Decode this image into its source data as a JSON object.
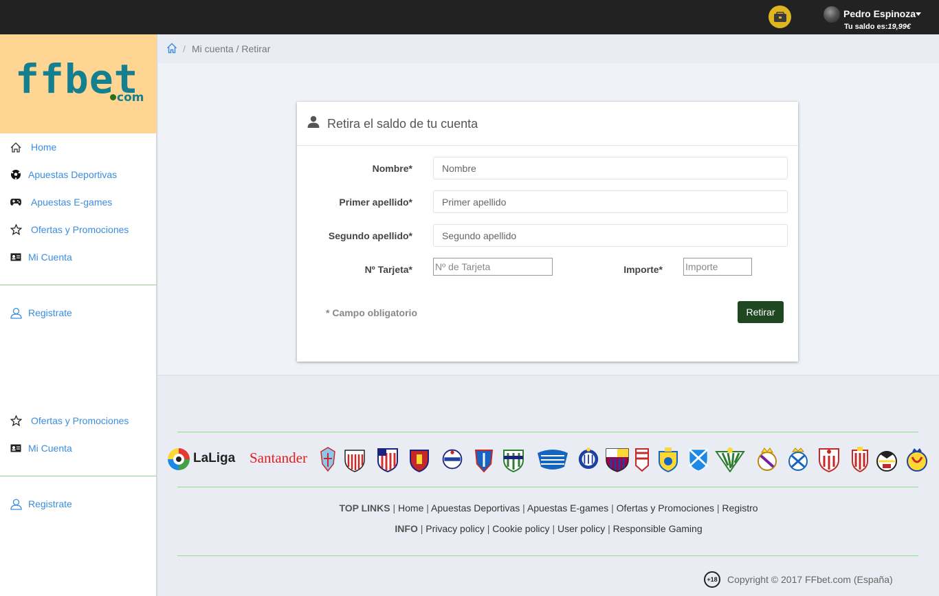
{
  "topbar": {
    "user_name": "Pedro Espinoza",
    "balance_label": "Tu saldo es:",
    "balance_amount": "19,99€",
    "wallet_icon": "wallet-icon"
  },
  "logo": {
    "brand": "ffbet",
    "suffix": "com"
  },
  "sidebar": {
    "items": [
      {
        "label": "Home",
        "icon": "home-icon"
      },
      {
        "label": "Apuestas Deportivas",
        "icon": "soccer-ball-icon"
      },
      {
        "label": "Apuestas E-games",
        "icon": "gamepad-icon"
      },
      {
        "label": "Ofertas y Promociones",
        "icon": "star-icon"
      },
      {
        "label": "Mi Cuenta",
        "icon": "id-card-icon"
      }
    ],
    "register": "Registrate",
    "items2": [
      {
        "label": "Ofertas y Promociones",
        "icon": "star-icon"
      },
      {
        "label": "Mi Cuenta",
        "icon": "id-card-icon"
      }
    ],
    "register2": "Registrate"
  },
  "breadcrumb": {
    "separator": "/",
    "path": "Mi cuenta / Retirar"
  },
  "form": {
    "title": "Retira el saldo de tu cuenta",
    "fields": {
      "nombre": {
        "label": "Nombre*",
        "placeholder": "Nombre"
      },
      "apellido1": {
        "label": "Primer apellido*",
        "placeholder": "Primer apellido"
      },
      "apellido2": {
        "label": "Segundo apellido*",
        "placeholder": "Segundo apellido"
      },
      "tarjeta": {
        "label": "Nº Tarjeta*",
        "placeholder": "Nº de Tarjeta"
      },
      "importe": {
        "label": "Importe*",
        "placeholder": "Importe"
      }
    },
    "required_note": "* Campo obligatorio",
    "submit": "Retirar"
  },
  "footer": {
    "league": {
      "name": "LaLiga",
      "sponsor": "Santander"
    },
    "top_links_heading": "TOP LINKS",
    "top_links": [
      "Home",
      "Apuestas Deportivas",
      "Apuestas E-games",
      "Ofertas y Promociones",
      "Registro"
    ],
    "info_heading": "INFO",
    "info_links": [
      "Privacy policy",
      "Cookie policy",
      "User policy",
      "Responsible Gaming"
    ],
    "age_badge": "+18",
    "copyright": "Copyright © 2017 FFbet.com (España)"
  }
}
